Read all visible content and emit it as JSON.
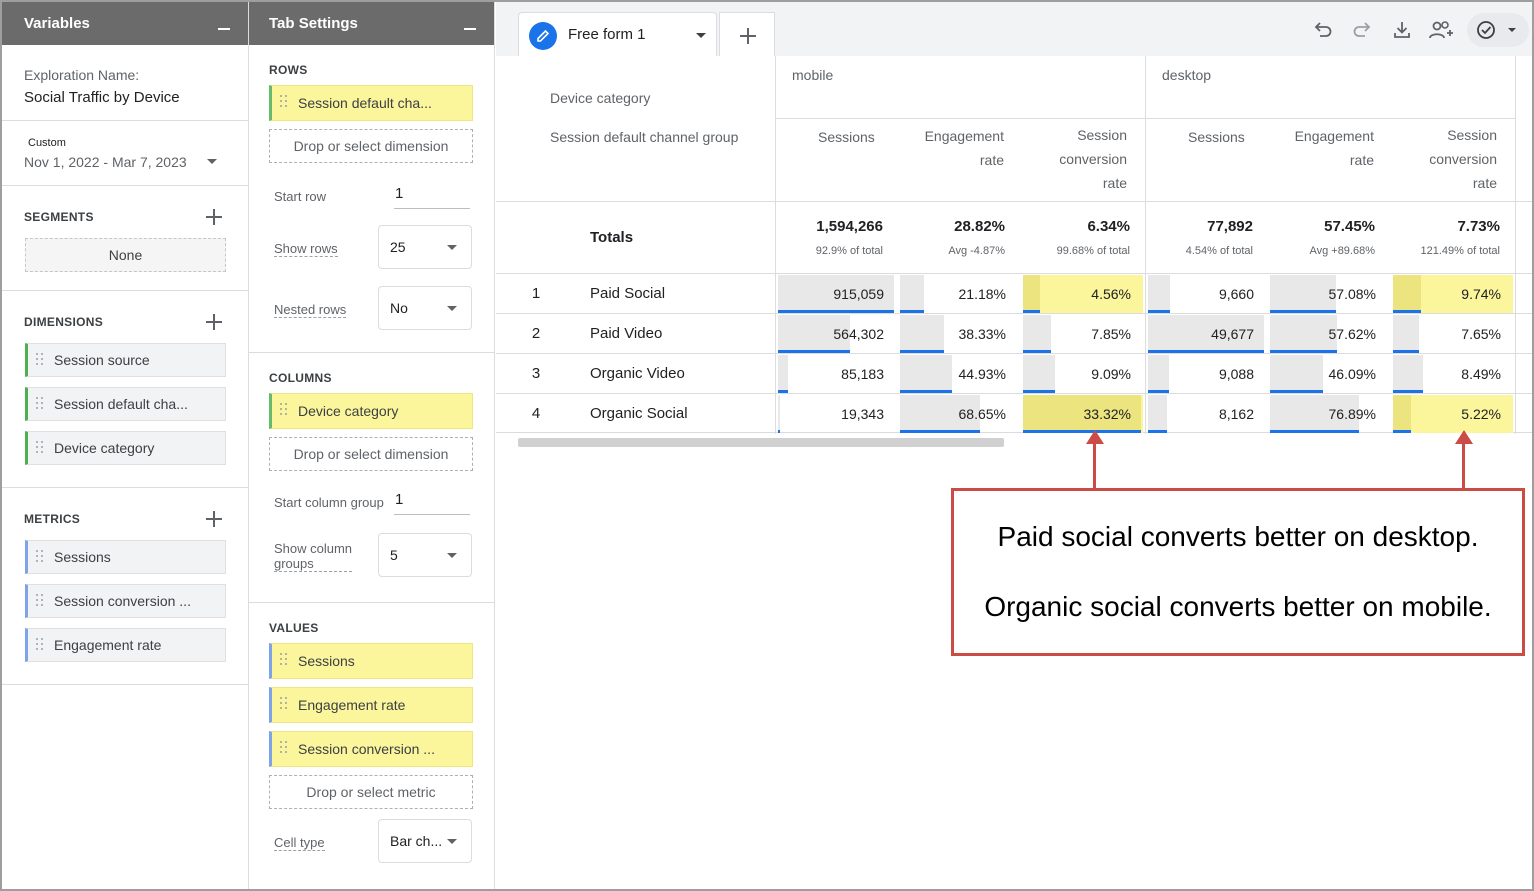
{
  "variables_panel": {
    "title": "Variables",
    "exploration_label": "Exploration Name:",
    "exploration_name": "Social Traffic by Device",
    "date_tag": "Custom",
    "date_range": "Nov 1, 2022 - Mar 7, 2023",
    "segments_title": "SEGMENTS",
    "segments_none": "None",
    "dimensions_title": "DIMENSIONS",
    "dimensions": [
      "Session source",
      "Session default cha...",
      "Device category"
    ],
    "metrics_title": "METRICS",
    "metrics": [
      "Sessions",
      "Session conversion ...",
      "Engagement rate"
    ]
  },
  "tab_settings": {
    "title": "Tab Settings",
    "rows_title": "ROWS",
    "rows_chip": "Session default cha...",
    "drop_dimension": "Drop or select dimension",
    "start_row_label": "Start row",
    "start_row": "1",
    "show_rows_label": "Show rows",
    "show_rows": "25",
    "nested_rows_label": "Nested rows",
    "nested_rows": "No",
    "columns_title": "COLUMNS",
    "columns_chip": "Device category",
    "start_column_group_label": "Start column group",
    "start_column_group": "1",
    "show_column_groups_label_1": "Show column",
    "show_column_groups_label_2": "groups",
    "show_column_groups": "5",
    "values_title": "VALUES",
    "values_chips": [
      "Sessions",
      "Engagement rate",
      "Session conversion ..."
    ],
    "drop_metric": "Drop or select metric",
    "cell_type_label": "Cell type",
    "cell_type": "Bar ch..."
  },
  "tab": {
    "label": "Free form 1"
  },
  "table": {
    "col_dim_label": "Device category",
    "row_dim_label": "Session default channel group",
    "groups": [
      "mobile",
      "desktop"
    ],
    "metric_headers": {
      "sessions": "Sessions",
      "engagement_1": "Engagement",
      "engagement_2": "rate",
      "conversion_1": "Session",
      "conversion_2": "conversion",
      "conversion_3": "rate"
    },
    "totals_label": "Totals",
    "totals": {
      "mobile": [
        {
          "value": "1,594,266",
          "sub": "92.9% of total"
        },
        {
          "value": "28.82%",
          "sub": "Avg -4.87%"
        },
        {
          "value": "6.34%",
          "sub": "99.68% of total"
        }
      ],
      "desktop": [
        {
          "value": "77,892",
          "sub": "4.54% of total"
        },
        {
          "value": "57.45%",
          "sub": "Avg +89.68%"
        },
        {
          "value": "7.73%",
          "sub": "121.49% of total"
        }
      ]
    },
    "rows": [
      {
        "num": "1",
        "label": "Paid Social",
        "mobile": [
          "915,059",
          "21.18%",
          "4.56%"
        ],
        "desktop": [
          "9,660",
          "57.08%",
          "9.74%"
        ]
      },
      {
        "num": "2",
        "label": "Paid Video",
        "mobile": [
          "564,302",
          "38.33%",
          "7.85%"
        ],
        "desktop": [
          "49,677",
          "57.62%",
          "7.65%"
        ]
      },
      {
        "num": "3",
        "label": "Organic Video",
        "mobile": [
          "85,183",
          "44.93%",
          "9.09%"
        ],
        "desktop": [
          "9,088",
          "46.09%",
          "8.49%"
        ]
      },
      {
        "num": "4",
        "label": "Organic Social",
        "mobile": [
          "19,343",
          "68.65%",
          "33.32%"
        ],
        "desktop": [
          "8,162",
          "76.89%",
          "5.22%"
        ]
      }
    ],
    "bar_fill": {
      "mobile": [
        [
          1.0,
          0.21,
          0.14
        ],
        [
          0.62,
          0.38,
          0.24
        ],
        [
          0.09,
          0.45,
          0.27
        ],
        [
          0.02,
          0.69,
          1.0
        ]
      ],
      "desktop": [
        [
          0.19,
          0.57,
          0.24
        ],
        [
          1.0,
          0.58,
          0.22
        ],
        [
          0.18,
          0.46,
          0.25
        ],
        [
          0.16,
          0.77,
          0.15
        ]
      ]
    },
    "highlighted_cells": [
      "mobile-0-2",
      "desktop-0-2",
      "mobile-3-2",
      "desktop-3-2"
    ]
  },
  "annotation": {
    "line1": "Paid social converts better on desktop.",
    "line2": "Organic social converts better on mobile."
  },
  "colors": {
    "highlight": "#fbf59c",
    "bar": "#1a73e8",
    "annotation": "#cc4b45",
    "panel_header": "#6b6b6b"
  }
}
